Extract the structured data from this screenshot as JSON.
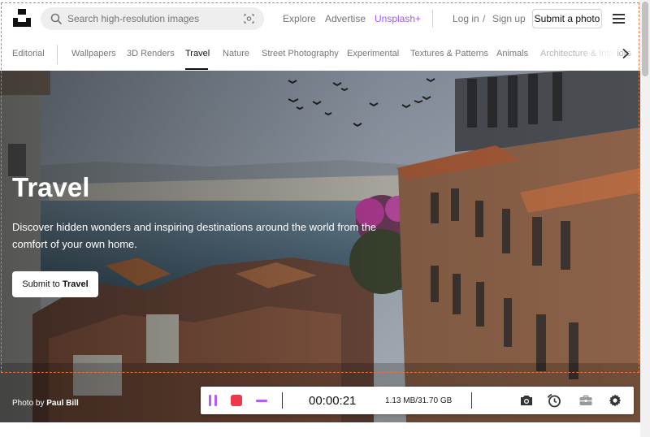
{
  "header": {
    "search_placeholder": "Search high-resolution images",
    "nav": [
      "Explore",
      "Advertise",
      "Unsplash+"
    ],
    "login": "Log in",
    "separator": "/",
    "signup": "Sign up",
    "submit_photo": "Submit a photo"
  },
  "topics": {
    "editorial": "Editorial",
    "items": [
      "Wallpapers",
      "3D Renders",
      "Travel",
      "Nature",
      "Street Photography",
      "Experimental",
      "Textures & Patterns",
      "Animals",
      "Architecture & Interiors"
    ],
    "active": "Travel"
  },
  "hero": {
    "title": "Travel",
    "description": "Discover hidden wonders and inspiring destinations around the world from the comfort of your own home.",
    "button_prefix": "Submit to ",
    "button_topic": "Travel",
    "credit_prefix": "Photo by ",
    "credit_name": "Paul Bill"
  },
  "recorder": {
    "timer": "00:00:21",
    "storage": "1.13 MB/31.70 GB",
    "accent": "#b35cff",
    "stop_color": "#f0374a",
    "frame_color": "#e8743b",
    "icons": [
      "pause-icon",
      "stop-icon",
      "minimize-icon",
      "camera-icon",
      "schedule-icon",
      "toolbox-icon",
      "settings-gear-icon"
    ]
  },
  "colors": {
    "plus_accent": "#a259ff",
    "muted_text": "#767676"
  }
}
